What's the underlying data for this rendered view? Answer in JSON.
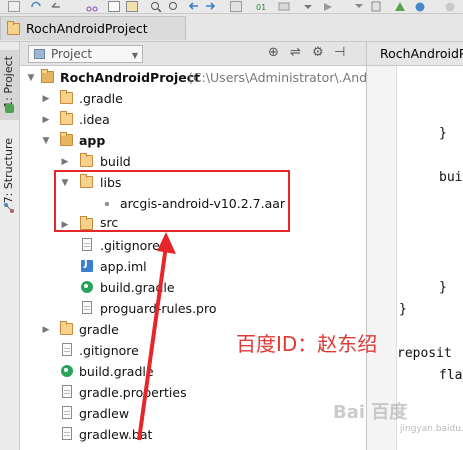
{
  "titlebar": {
    "tab_label": "RochAndroidProject"
  },
  "sidebar": {
    "tab_project": "1: Project",
    "tab_structure": "7: Structure"
  },
  "panel": {
    "view_select": "Project"
  },
  "tree": {
    "root_name": "RochAndroidProject",
    "root_path": "(C:\\Users\\Administrator\\.Andro",
    "items": [
      {
        "label": ".gradle"
      },
      {
        "label": ".idea"
      },
      {
        "label": "app"
      },
      {
        "label": "build"
      },
      {
        "label": "libs"
      },
      {
        "label": "arcgis-android-v10.2.7.aar"
      },
      {
        "label": "src"
      },
      {
        "label": ".gitignore"
      },
      {
        "label": "app.iml"
      },
      {
        "label": "build.gradle"
      },
      {
        "label": "proguard-rules.pro"
      },
      {
        "label": "gradle"
      },
      {
        "label": ".gitignore"
      },
      {
        "label": "build.gradle"
      },
      {
        "label": "gradle.properties"
      },
      {
        "label": "gradlew"
      },
      {
        "label": "gradlew.bat"
      }
    ]
  },
  "editor": {
    "tab_label": "RochAndroidP",
    "lines": [
      "}",
      "bui",
      "}",
      "}",
      "reposit",
      "fla"
    ]
  },
  "annotation": {
    "text": "百度ID：赵东绍"
  },
  "watermark": {
    "text": "Bai 百度",
    "sub": "jingyan.baidu.com"
  },
  "colors": {
    "annotation_red": "#e5262a",
    "folder": "#f7d28a"
  }
}
